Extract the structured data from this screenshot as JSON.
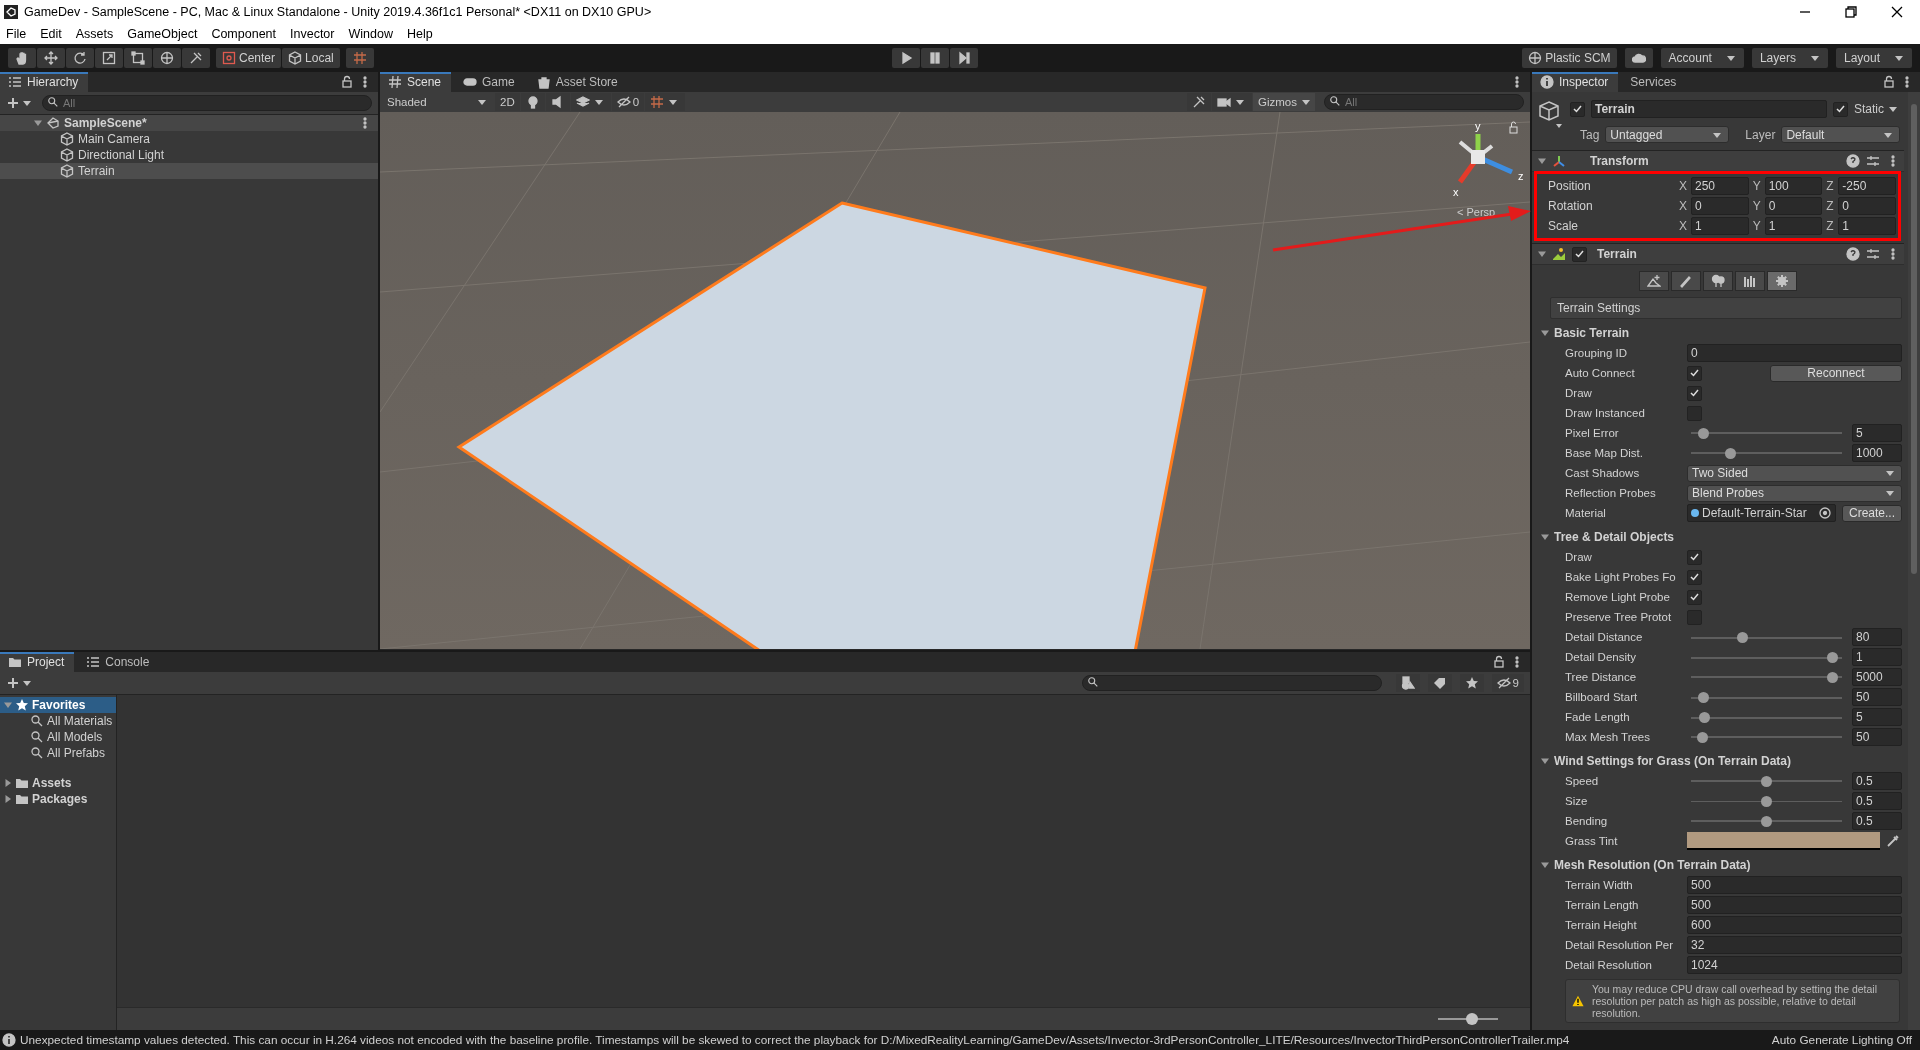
{
  "window": {
    "title": "GameDev - SampleScene - PC, Mac & Linux Standalone - Unity 2019.4.36f1c1 Personal* <DX11 on DX10 GPU>"
  },
  "menu": [
    "File",
    "Edit",
    "Assets",
    "GameObject",
    "Component",
    "Invector",
    "Window",
    "Help"
  ],
  "toolbar": {
    "pivot": "Center",
    "space": "Local",
    "plastic": "Plastic SCM",
    "account": "Account",
    "layers": "Layers",
    "layout": "Layout"
  },
  "hierarchy": {
    "tab": "Hierarchy",
    "search_placeholder": "All",
    "tree": [
      {
        "label": "SampleScene*",
        "expanded": true,
        "children": [
          {
            "label": "Main Camera",
            "selected": false
          },
          {
            "label": "Directional Light",
            "selected": false
          },
          {
            "label": "Terrain",
            "selected": true
          }
        ]
      }
    ]
  },
  "scene": {
    "tabs": [
      {
        "label": "Scene",
        "selected": true
      },
      {
        "label": "Game",
        "selected": false
      },
      {
        "label": "Asset Store",
        "selected": false
      }
    ],
    "shading": "Shaded",
    "mode_2d": "2D",
    "hidden_count": "0",
    "gizmos": "Gizmos",
    "search_placeholder": "All",
    "gizmo_labels": {
      "y": "y",
      "x": "x",
      "z": "z",
      "projection": "< Persp"
    }
  },
  "inspector": {
    "tabs": [
      {
        "label": "Inspector",
        "selected": true
      },
      {
        "label": "Services",
        "selected": false
      }
    ],
    "object": {
      "name": "Terrain",
      "active": true,
      "static": true,
      "static_label": "Static",
      "tag_label": "Tag",
      "tag": "Untagged",
      "layer_label": "Layer",
      "layer": "Default"
    },
    "transform": {
      "title": "Transform",
      "rows": [
        {
          "label": "Position",
          "values": [
            {
              "axis": "X",
              "value": "250"
            },
            {
              "axis": "Y",
              "value": "100"
            },
            {
              "axis": "Z",
              "value": "-250"
            }
          ]
        },
        {
          "label": "Rotation",
          "values": [
            {
              "axis": "X",
              "value": "0"
            },
            {
              "axis": "Y",
              "value": "0"
            },
            {
              "axis": "Z",
              "value": "0"
            }
          ]
        },
        {
          "label": "Scale",
          "values": [
            {
              "axis": "X",
              "value": "1"
            },
            {
              "axis": "Y",
              "value": "1"
            },
            {
              "axis": "Z",
              "value": "1"
            }
          ]
        }
      ]
    },
    "terrain": {
      "title": "Terrain",
      "enabled": true,
      "tools": [
        {
          "kind": "raise",
          "selected": false
        },
        {
          "kind": "paint",
          "selected": false
        },
        {
          "kind": "trees",
          "selected": false
        },
        {
          "kind": "details",
          "selected": false
        },
        {
          "kind": "settings",
          "selected": true
        }
      ],
      "settings_title": "Terrain Settings",
      "sections": [
        {
          "title": "Basic Terrain",
          "expanded": true,
          "rows": [
            {
              "kind": "text",
              "label": "Grouping ID",
              "value": "0"
            },
            {
              "kind": "checkbox",
              "label": "Auto Connect",
              "checked": true,
              "button": "Reconnect"
            },
            {
              "kind": "checkbox",
              "label": "Draw",
              "checked": true
            },
            {
              "kind": "checkbox",
              "label": "Draw Instanced",
              "checked": false
            },
            {
              "kind": "slider",
              "label": "Pixel Error",
              "level": 0.05,
              "value": "5"
            },
            {
              "kind": "slider",
              "label": "Base Map Dist.",
              "level": 0.24,
              "value": "1000"
            },
            {
              "kind": "dropdown",
              "label": "Cast Shadows",
              "value": "Two Sided"
            },
            {
              "kind": "dropdown",
              "label": "Reflection Probes",
              "value": "Blend Probes"
            },
            {
              "kind": "object",
              "label": "Material",
              "value": "Default-Terrain-Star",
              "button": "Create..."
            }
          ]
        },
        {
          "title": "Tree & Detail Objects",
          "expanded": true,
          "rows": [
            {
              "kind": "checkbox",
              "label": "Draw",
              "checked": true
            },
            {
              "kind": "checkbox",
              "label": "Bake Light Probes Fo",
              "checked": true
            },
            {
              "kind": "checkbox",
              "label": "Remove Light Probe",
              "checked": true
            },
            {
              "kind": "checkbox",
              "label": "Preserve Tree Protot",
              "checked": false
            },
            {
              "kind": "slider",
              "label": "Detail Distance",
              "level": 0.33,
              "value": "80"
            },
            {
              "kind": "slider",
              "label": "Detail Density",
              "level": 0.97,
              "value": "1"
            },
            {
              "kind": "slider",
              "label": "Tree Distance",
              "level": 0.97,
              "value": "5000"
            },
            {
              "kind": "slider",
              "label": "Billboard Start",
              "level": 0.05,
              "value": "50"
            },
            {
              "kind": "slider",
              "label": "Fade Length",
              "level": 0.06,
              "value": "5"
            },
            {
              "kind": "slider",
              "label": "Max Mesh Trees",
              "level": 0.04,
              "value": "50"
            }
          ]
        },
        {
          "title": "Wind Settings for Grass (On Terrain Data)",
          "expanded": true,
          "rows": [
            {
              "kind": "slider",
              "label": "Speed",
              "level": 0.5,
              "value": "0.5"
            },
            {
              "kind": "slider",
              "label": "Size",
              "level": 0.5,
              "value": "0.5"
            },
            {
              "kind": "slider",
              "label": "Bending",
              "level": 0.5,
              "value": "0.5"
            },
            {
              "kind": "color",
              "label": "Grass Tint",
              "color": "#b19a80"
            }
          ]
        },
        {
          "title": "Mesh Resolution (On Terrain Data)",
          "expanded": true,
          "rows": [
            {
              "kind": "text",
              "label": "Terrain Width",
              "value": "500"
            },
            {
              "kind": "text",
              "label": "Terrain Length",
              "value": "500"
            },
            {
              "kind": "text",
              "label": "Terrain Height",
              "value": "600"
            },
            {
              "kind": "text",
              "label": "Detail Resolution Per",
              "value": "32"
            },
            {
              "kind": "text",
              "label": "Detail Resolution",
              "value": "1024"
            }
          ]
        }
      ],
      "warning": "You may reduce CPU draw call overhead by setting the detail resolution per patch as high as possible, relative to detail resolution."
    }
  },
  "project": {
    "tabs": [
      {
        "label": "Project",
        "selected": true
      },
      {
        "label": "Console",
        "selected": false
      }
    ],
    "tree": [
      {
        "label": "Favorites",
        "kind": "favorites",
        "expanded": true,
        "selected": true,
        "children": [
          {
            "label": "All Materials"
          },
          {
            "label": "All Models"
          },
          {
            "label": "All Prefabs"
          }
        ]
      },
      {
        "label": "Assets",
        "kind": "folder",
        "expanded": false,
        "selected": false
      },
      {
        "label": "Packages",
        "kind": "folder",
        "expanded": false,
        "selected": false
      }
    ],
    "hidden_count": "9",
    "zoom": {
      "level": 0.57
    }
  },
  "status_bar": {
    "message": "Unexpected timestamp values detected. This can occur in H.264 videos not encoded with the baseline profile. Timestamps will be skewed to correct the playback for D:/MixedRealityLearning/GameDev/Assets/Invector-3rdPersonController_LITE/Resources/InvectorThirdPersonControllerTrailer.mp4",
    "lighting": "Auto Generate Lighting Off"
  }
}
